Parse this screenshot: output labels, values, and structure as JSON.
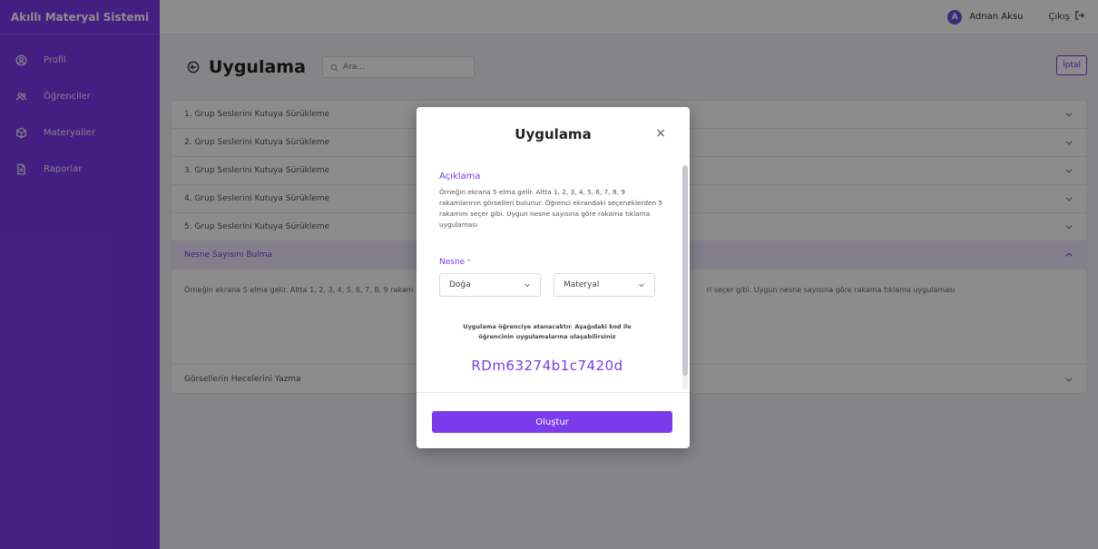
{
  "app": {
    "title": "Akıllı Materyal Sistemi"
  },
  "sidebar": {
    "items": [
      {
        "label": "Profil",
        "icon": "user-circle-icon"
      },
      {
        "label": "Öğrenciler",
        "icon": "users-icon"
      },
      {
        "label": "Materyaller",
        "icon": "cube-icon"
      },
      {
        "label": "Raporlar",
        "icon": "document-icon"
      }
    ]
  },
  "topbar": {
    "avatar_initial": "A",
    "user_name": "Adnan Aksu",
    "logout_label": "Çıkış"
  },
  "main": {
    "title": "Uygulama",
    "search_placeholder": "Ara...",
    "cancel_label": "İptal",
    "accordion": [
      {
        "label": "1. Grup Seslerini Kutuya Sürükleme"
      },
      {
        "label": "2. Grup Seslerini Kutuya Sürükleme"
      },
      {
        "label": "3. Grup Seslerini Kutuya Sürükleme"
      },
      {
        "label": "4. Grup Seslerini Kutuya Sürükleme"
      },
      {
        "label": "5. Grup Seslerini Kutuya Sürükleme"
      },
      {
        "label": "Nesne Sayısını Bulma",
        "expanded": true
      },
      {
        "label": "Görsellerin Hecelerini Yazma"
      }
    ],
    "expanded_body_left": "Örneğin ekrana 5 elma gelir. Altta 1, 2, 3, 4, 5, 6, 7, 8, 9 rakam",
    "expanded_body_right": "ri seçer gibi. Uygun nesne sayısına göre rakama tıklama uygulaması"
  },
  "modal": {
    "title": "Uygulama",
    "close_label": "×",
    "description_label": "Açıklama",
    "description_text": "Örneğin ekrana 5 elma gelir. Altta 1, 2, 3, 4, 5, 6, 7, 8, 9 rakamlarının görselleri bulunur. Öğrenci ekrandaki seçeneklerden 5 rakamını seçer gibi. Uygun nesne sayısına göre rakama tıklama uygulaması",
    "nesne_label": "Nesne",
    "required_mark": "*",
    "select1_value": "Doğa",
    "select2_value": "Materyal",
    "info_line1": "Uygulama öğrenciye atanacaktır. Aşağıdaki kod ile",
    "info_line2": "öğrencinin uygulamalarına ulaşabilirsiniz",
    "code": "RDm63274b1c7420d",
    "create_label": "Oluştur"
  },
  "colors": {
    "accent": "#7c3aed",
    "overlay": "rgba(0,0,0,0.45)"
  }
}
